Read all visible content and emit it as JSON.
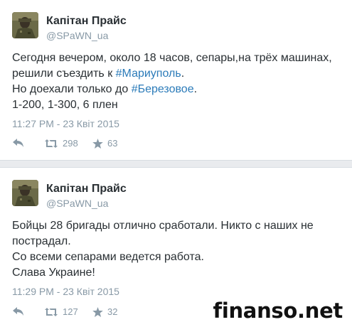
{
  "tweets": [
    {
      "author_name": "Капітан Прайс",
      "author_handle": "@SPaWN_ua",
      "text": {
        "line1": "Сегодня вечером, около 18 часов, сепары,на трёх машинах,",
        "line2_prefix": "решили съездить к ",
        "hashtag1": "#Мариуполь",
        "line2_suffix": ".",
        "line3_prefix": "Но доехали только до ",
        "hashtag2": "#Березовое",
        "line3_suffix": ".",
        "line4": "1-200, 1-300, 6 плен"
      },
      "timestamp": "11:27 PM - 23 Квіт 2015",
      "retweets": "298",
      "favorites": "63",
      "icons": [
        "reply-icon",
        "retweet-icon",
        "favorite-star-icon"
      ]
    },
    {
      "author_name": "Капітан Прайс",
      "author_handle": "@SPaWN_ua",
      "text": {
        "line1": "Бойцы 28 бригады отлично сработали. Никто с наших не",
        "line2": "пострадал.",
        "line3": "Со всеми сепарами ведется работа.",
        "line4": "Слава Украине!"
      },
      "timestamp": "11:29 PM - 23 Квіт 2015",
      "retweets": "127",
      "favorites": "32",
      "icons": [
        "reply-icon",
        "retweet-icon",
        "favorite-star-icon"
      ]
    }
  ],
  "watermark": "finanso.net",
  "colors": {
    "link": "#2b7bb9",
    "text": "#292f33",
    "muted": "#8899a6",
    "background": "#e9ebee"
  }
}
